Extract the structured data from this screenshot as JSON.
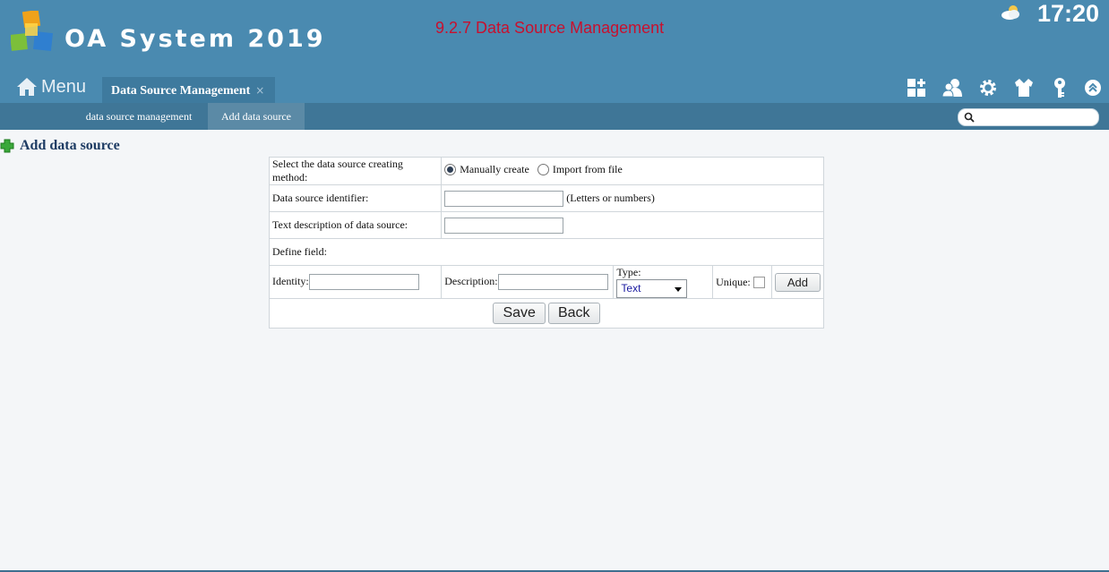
{
  "app": {
    "title": "OA System 2019",
    "page_heading": "9.2.7 Data Source Management",
    "clock": "17:20",
    "weather_icon": "cloud-sun-icon"
  },
  "nav": {
    "menu_label": "Menu",
    "active_tab": "Data Source Management",
    "tab_close": "×"
  },
  "toolbar": {
    "icons": [
      "apps-add-icon",
      "users-icon",
      "gear-icon",
      "shirt-icon",
      "key-icon",
      "collapse-up-icon"
    ]
  },
  "subnav": {
    "items": [
      {
        "label": "data source management",
        "active": false
      },
      {
        "label": "Add data source",
        "active": true
      }
    ],
    "search_placeholder": ""
  },
  "section": {
    "title": "Add data source"
  },
  "form": {
    "method_label": "Select the data source creating method:",
    "method_options": [
      {
        "label": "Manually create",
        "checked": true
      },
      {
        "label": "Import from file",
        "checked": false
      }
    ],
    "identifier_label": "Data source identifier:",
    "identifier_value": "",
    "identifier_hint": "(Letters or numbers)",
    "description_label": "Text description of data source:",
    "description_value": "",
    "define_field_label": "Define field:",
    "field_row": {
      "identity_label": "Identity:",
      "identity_value": "",
      "description_label": "Description:",
      "description_value": "",
      "type_label": "Type:",
      "type_value": "Text",
      "unique_label": "Unique:",
      "unique_checked": false,
      "add_label": "Add"
    },
    "save_label": "Save",
    "back_label": "Back"
  },
  "colors": {
    "header": "#4a8ab0",
    "subnav": "#3f7697",
    "heading_red": "#c8102e"
  }
}
